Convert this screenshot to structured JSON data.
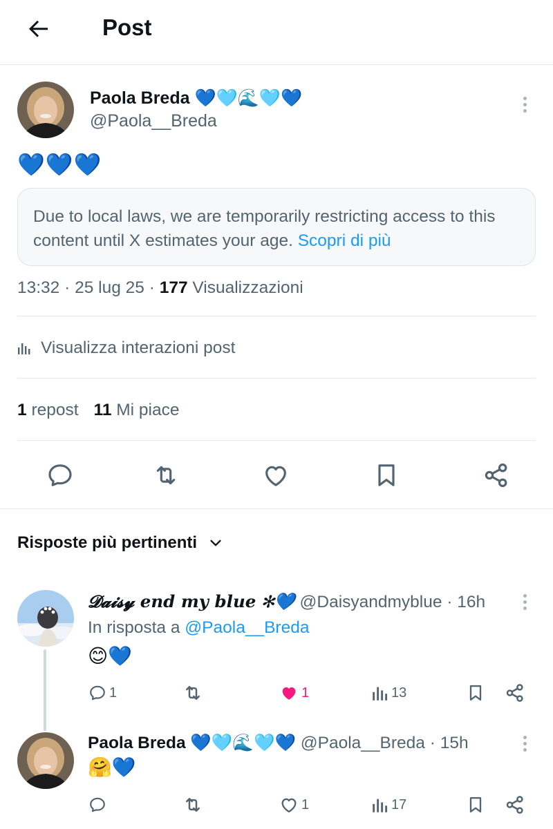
{
  "header": {
    "title": "Post"
  },
  "post": {
    "author_name": "Paola Breda 💙🩵🌊🩵💙",
    "author_handle": "@Paola__Breda",
    "text": "💙💙💙",
    "notice_text": "Due to local laws, we are temporarily restricting access to this content until X estimates your age.",
    "notice_link": "Scopri di più",
    "time": "13:32",
    "date": "25 lug 25",
    "views_count": "177",
    "views_label": "Visualizzazioni",
    "view_interactions_label": "Visualizza interazioni post",
    "repost_count": "1",
    "repost_label": "repost",
    "like_count": "11",
    "like_label": "Mi piace"
  },
  "replies_sort": {
    "label": "Risposte più pertinenti"
  },
  "replies": [
    {
      "name": "𝓓𝓪𝓲𝓼𝔂 end my blue ✻💙",
      "handle": "@Daisyandmyblue",
      "time": "16h",
      "in_reply_prefix": "In risposta a",
      "in_reply_handle": "@Paola__Breda",
      "text": "😊💙",
      "reply_count": "1",
      "retweet_count": "",
      "like_count": "1",
      "view_count": "13",
      "liked": true
    },
    {
      "name": "Paola Breda 💙🩵🌊🩵💙",
      "handle": "@Paola__Breda",
      "time": "15h",
      "text": "🤗💙",
      "reply_count": "",
      "retweet_count": "",
      "like_count": "1",
      "view_count": "17",
      "liked": false
    }
  ],
  "colors": {
    "accent": "#1d9bf0",
    "text_primary": "#0f1419",
    "text_secondary": "#536471",
    "like_pink": "#f91880",
    "divider": "#e6e9ec"
  },
  "icons": [
    "arrow-left-icon",
    "kebab-menu-icon",
    "bar-chart-icon",
    "comment-icon",
    "retweet-icon",
    "heart-icon",
    "bookmark-icon",
    "share-icon",
    "chevron-down-icon"
  ]
}
